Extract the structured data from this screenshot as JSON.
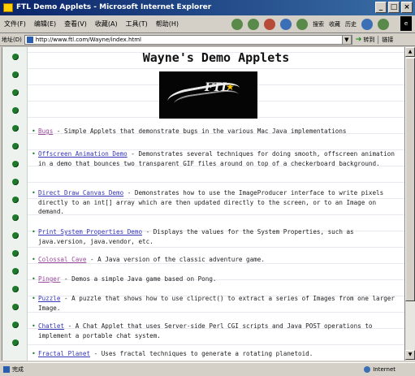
{
  "window": {
    "title": "FTL Demo Applets - Microsoft Internet Explorer",
    "min_label": "_",
    "max_label": "□",
    "close_label": "×"
  },
  "menubar": {
    "items": [
      "文件(F)",
      "编辑(E)",
      "查看(V)",
      "收藏(A)",
      "工具(T)",
      "帮助(H)"
    ],
    "toolbar_labels": [
      "搜索",
      "收藏",
      "历史"
    ]
  },
  "addressbar": {
    "label": "地址(D)",
    "url": "http://www.ftl.com/Wayne/index.html",
    "go_label": "转到",
    "links_label": "链接"
  },
  "page": {
    "title": "Wayne's Demo Applets",
    "logo_text": "FTL",
    "entries": [
      {
        "link": "Bugs",
        "text": "Simple Applets that demonstrate bugs in the various Mac Java implementations",
        "visited": true
      },
      {
        "link": "Offscreen Animation Demo",
        "text": "Demonstrates several techniques for doing smooth, offscreen animation in a demo that bounces two transparent GIF files around on top of a checkerboard background.",
        "visited": false
      },
      {
        "link": "Direct Draw Canvas Demo",
        "text": "Demonstrates how to use the ImageProducer interface to write pixels directly to an int[] array which are then updated directly to the screen, or to an Image on demand.",
        "visited": false
      },
      {
        "link": "Print System Properties Demo",
        "text": "Displays the values for the System Properties, such as java.version, java.vendor, etc.",
        "visited": false
      },
      {
        "link": "Colossal Cave",
        "text": "A Java version of the classic adventure game.",
        "visited": true
      },
      {
        "link": "Pinger",
        "text": "Demos a simple Java game based on Pong.",
        "visited": true
      },
      {
        "link": "Puzzle",
        "text": "A puzzle that shows how to use cliprect() to extract a series of Images from one larger Image.",
        "visited": false
      },
      {
        "link": "Chatlet",
        "text": "A Chat Applet that uses Server-side Perl CGI scripts and Java POST operations to implement a portable chat system.",
        "visited": false
      },
      {
        "link": "Fractal Planet",
        "text": "Uses fractal techniques to generate a rotating planetoid.",
        "visited": false
      }
    ]
  },
  "statusbar": {
    "left_text": "完成",
    "zone_text": "Internet"
  }
}
